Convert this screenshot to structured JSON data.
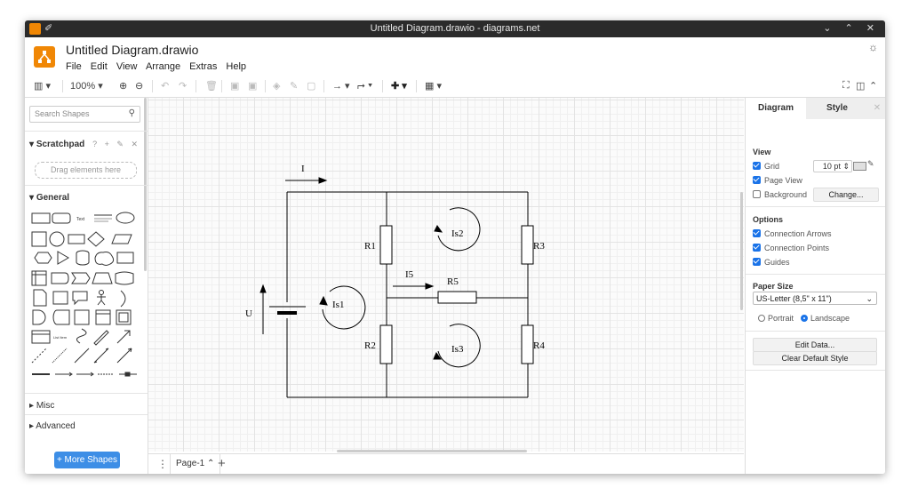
{
  "window": {
    "title": "Untitled Diagram.drawio - diagrams.net"
  },
  "app": {
    "doc_title": "Untitled Diagram.drawio",
    "accent": "#f08705"
  },
  "menu": {
    "items": [
      "File",
      "Edit",
      "View",
      "Arrange",
      "Extras",
      "Help"
    ]
  },
  "toolbar": {
    "zoom": "100%"
  },
  "sidebar": {
    "search_placeholder": "Search Shapes",
    "scratchpad_title": "Scratchpad",
    "scratchpad_ctrls": "? + ✎ ✕",
    "dropzone": "Drag elements here",
    "general_title": "General",
    "misc_title": "Misc",
    "advanced_title": "Advanced",
    "more_shapes": "+ More Shapes"
  },
  "pages": {
    "current": "Page-1"
  },
  "panel": {
    "tab_diagram": "Diagram",
    "tab_style": "Style",
    "view_title": "View",
    "grid_label": "Grid",
    "grid_size": "10 pt",
    "page_view_label": "Page View",
    "background_label": "Background",
    "change_button": "Change...",
    "options_title": "Options",
    "connection_arrows": "Connection Arrows",
    "connection_points": "Connection Points",
    "guides": "Guides",
    "paper_size_title": "Paper Size",
    "paper_size": "US-Letter (8,5\" x 11\")",
    "portrait": "Portrait",
    "landscape": "Landscape",
    "edit_data": "Edit Data...",
    "clear_style": "Clear Default Style"
  },
  "diagram": {
    "labels": {
      "I": "I",
      "U": "U",
      "I5": "I5",
      "R1": "R1",
      "R2": "R2",
      "R3": "R3",
      "R4": "R4",
      "R5": "R5",
      "Is1": "Is1",
      "Is2": "Is2",
      "Is3": "Is3"
    }
  }
}
